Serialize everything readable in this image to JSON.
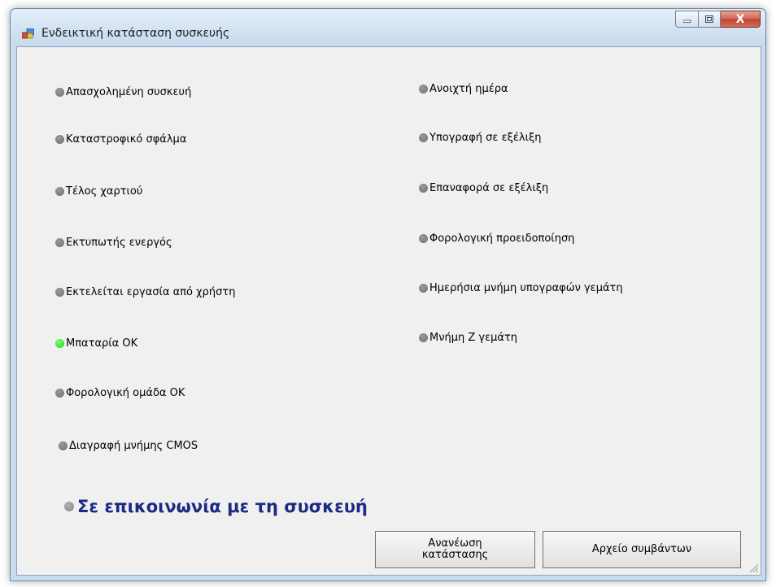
{
  "window": {
    "title": "Ενδεικτική κατάσταση συσκευής",
    "close_label": "X"
  },
  "left_indicators": [
    {
      "label": "Απασχολημένη συσκευή",
      "state": "off"
    },
    {
      "label": "Καταστροφικό σφάλμα",
      "state": "off"
    },
    {
      "label": "Τέλος χαρτιού",
      "state": "off"
    },
    {
      "label": "Εκτυπωτής ενεργός",
      "state": "off"
    },
    {
      "label": "Εκτελείται εργασία από χρήστη",
      "state": "off"
    },
    {
      "label": "Μπαταρία ΟΚ",
      "state": "on"
    },
    {
      "label": "Φορολογική ομάδα ΟΚ",
      "state": "off"
    },
    {
      "label": "Διαγραφή μνήμης CMOS",
      "state": "off"
    }
  ],
  "right_indicators": [
    {
      "label": "Ανοιχτή ημέρα",
      "state": "off"
    },
    {
      "label": "Υπογραφή σε εξέλιξη",
      "state": "off"
    },
    {
      "label": "Επαναφορά σε εξέλιξη",
      "state": "off"
    },
    {
      "label": "Φορολογική προειδοποίηση",
      "state": "off"
    },
    {
      "label": "Ημερήσια μνήμη υπογραφών γεμάτη",
      "state": "off"
    },
    {
      "label": "Μνήμη Ζ γεμάτη",
      "state": "off"
    }
  ],
  "communication_status": "Σε επικοινωνία με τη συσκευή",
  "buttons": {
    "refresh_line1": "Ανανέωση",
    "refresh_line2": "κατάστασης",
    "event_log": "Αρχείο συμβάντων"
  },
  "colors": {
    "indicator_on": "#12d312",
    "indicator_off": "#6e6e6e",
    "status_text": "#1b2a85"
  }
}
